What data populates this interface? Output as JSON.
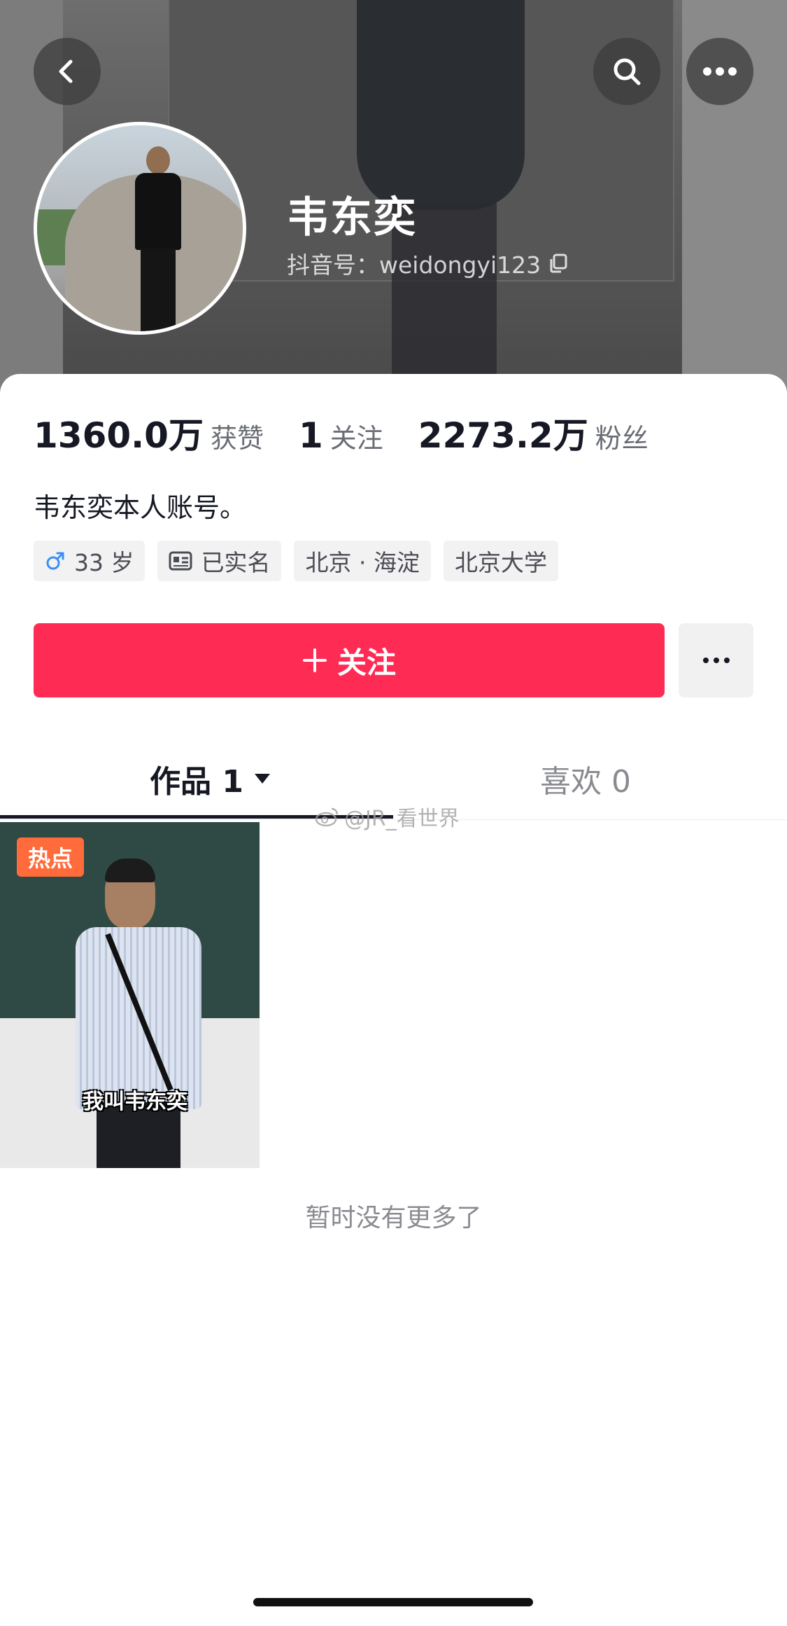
{
  "profile": {
    "name": "韦东奕",
    "douyin_id": "抖音号：weidongyi123",
    "bio": "韦东奕本人账号。"
  },
  "stats": [
    {
      "value": "1360.0万",
      "label": "获赞"
    },
    {
      "value": "1",
      "label": "关注"
    },
    {
      "value": "2273.2万",
      "label": "粉丝"
    }
  ],
  "tags": {
    "gender_age": "33 岁",
    "verified": "已实名",
    "location": "北京 · 海淀",
    "school": "北京大学"
  },
  "actions": {
    "follow_label": "关注",
    "more_label": "···"
  },
  "tabs": {
    "works": "作品 1",
    "likes": "喜欢 0"
  },
  "watermark": "@JR_看世界",
  "videos": [
    {
      "badge": "热点",
      "caption": "我叫韦东奕"
    }
  ],
  "footer": {
    "no_more": "暂时没有更多了"
  },
  "colors": {
    "follow_button": "#fe2c55",
    "hot_badge": "#ff6b3a",
    "male_symbol": "#3a8ef6"
  },
  "icons": {
    "back": "chevron-left-icon",
    "search": "search-icon",
    "more": "more-dots-icon",
    "copy": "copy-icon",
    "gender": "male-icon",
    "verified": "id-card-icon",
    "plus": "plus-icon",
    "dropdown": "triangle-down-icon"
  }
}
